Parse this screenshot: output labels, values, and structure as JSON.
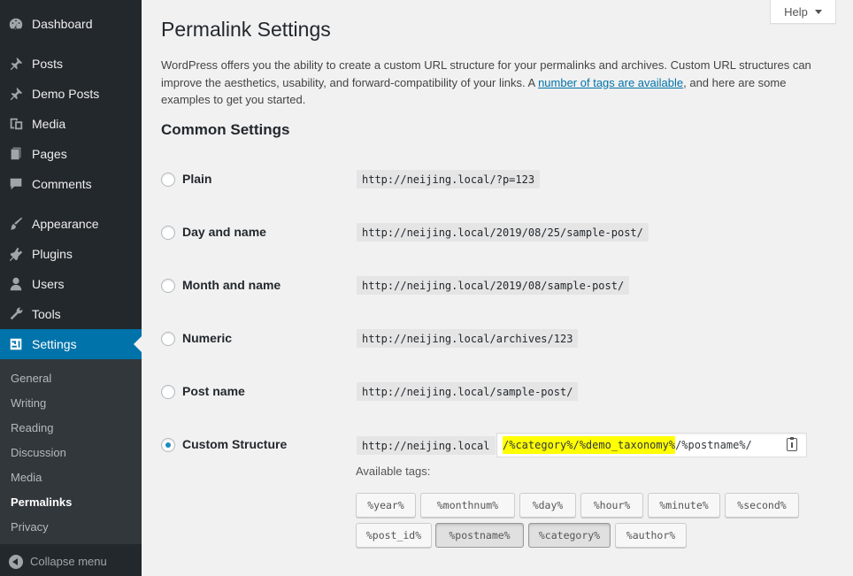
{
  "sidebar": {
    "items": [
      {
        "label": "Dashboard",
        "icon": "dashboard-icon"
      },
      {
        "label": "Posts",
        "icon": "pin-icon"
      },
      {
        "label": "Demo Posts",
        "icon": "pin-icon"
      },
      {
        "label": "Media",
        "icon": "media-icon"
      },
      {
        "label": "Pages",
        "icon": "pages-icon"
      },
      {
        "label": "Comments",
        "icon": "comments-icon"
      },
      {
        "label": "Appearance",
        "icon": "brush-icon"
      },
      {
        "label": "Plugins",
        "icon": "plugin-icon"
      },
      {
        "label": "Users",
        "icon": "users-icon"
      },
      {
        "label": "Tools",
        "icon": "wrench-icon"
      },
      {
        "label": "Settings",
        "icon": "settings-icon",
        "active": true
      }
    ],
    "submenu": [
      "General",
      "Writing",
      "Reading",
      "Discussion",
      "Media",
      "Permalinks",
      "Privacy"
    ],
    "submenu_current": "Permalinks",
    "collapse_label": "Collapse menu",
    "active_color": "#0073aa"
  },
  "help": {
    "label": "Help"
  },
  "page": {
    "title": "Permalink Settings",
    "intro_before": "WordPress offers you the ability to create a custom URL structure for your permalinks and archives. Custom URL structures can improve the aesthetics, usability, and forward-compatibility of your links. A ",
    "intro_link": "number of tags are available",
    "intro_after": ", and here are some examples to get you started.",
    "common_heading": "Common Settings"
  },
  "options": [
    {
      "label": "Plain",
      "example": "http://neijing.local/?p=123",
      "checked": false
    },
    {
      "label": "Day and name",
      "example": "http://neijing.local/2019/08/25/sample-post/",
      "checked": false
    },
    {
      "label": "Month and name",
      "example": "http://neijing.local/2019/08/sample-post/",
      "checked": false
    },
    {
      "label": "Numeric",
      "example": "http://neijing.local/archives/123",
      "checked": false
    },
    {
      "label": "Post name",
      "example": "http://neijing.local/sample-post/",
      "checked": false
    },
    {
      "label": "Custom Structure",
      "example": "http://neijing.local",
      "checked": true
    }
  ],
  "custom": {
    "highlighted": "/%category%/%demo_taxonomy%",
    "rest": "/%postname%/",
    "highlight_color": "#ffff00"
  },
  "available_tags_label": "Available tags:",
  "tags_row1": [
    "%year%",
    "%monthnum%",
    "%day%",
    "%hour%",
    "%minute%",
    "%second%"
  ],
  "tags_row2": [
    "%post_id%",
    "%postname%",
    "%category%",
    "%author%"
  ],
  "active_tags": [
    "%postname%",
    "%category%"
  ]
}
